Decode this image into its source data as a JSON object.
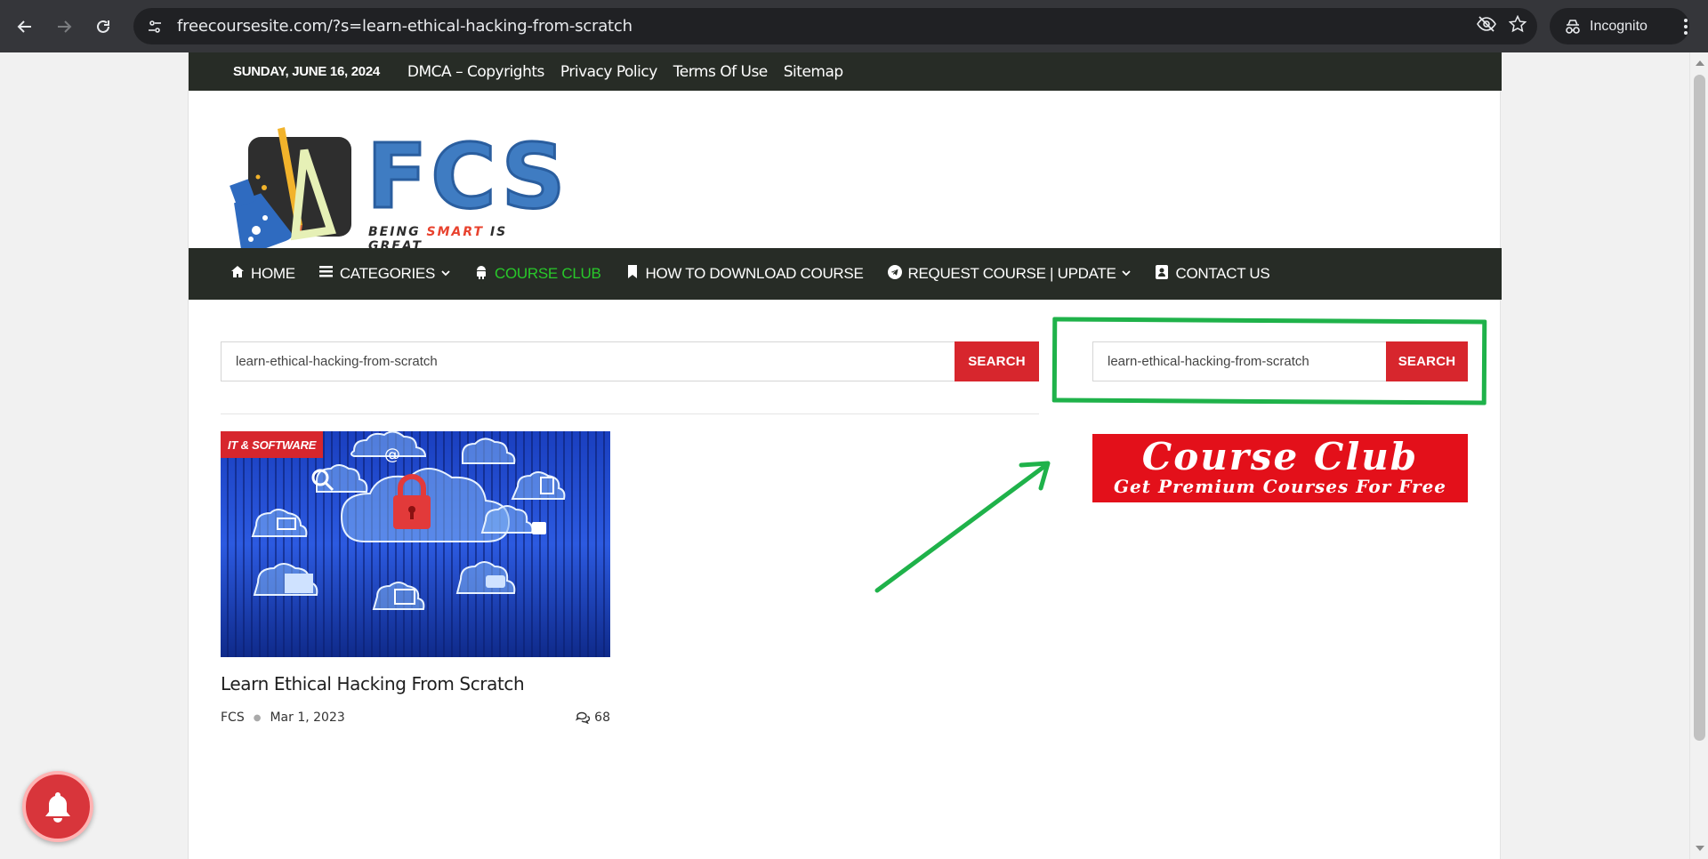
{
  "browser": {
    "url": "freecoursesite.com/?s=learn-ethical-hacking-from-scratch",
    "profile_label": "Incognito"
  },
  "topbar": {
    "date": "SUNDAY, JUNE 16, 2024",
    "links": [
      "DMCA – Copyrights",
      "Privacy Policy",
      "Terms Of Use",
      "Sitemap"
    ]
  },
  "logo": {
    "letters": "FCS",
    "tag_before": "BEING ",
    "tag_highlight": "SMART",
    "tag_after": " IS GREAT"
  },
  "mainnav": {
    "items": [
      {
        "label": "HOME",
        "icon": "home-icon"
      },
      {
        "label": "CATEGORIES",
        "icon": "menu-icon"
      },
      {
        "label": "COURSE CLUB",
        "icon": "android-icon"
      },
      {
        "label": "HOW TO DOWNLOAD COURSE",
        "icon": "bookmark-icon"
      },
      {
        "label": "REQUEST COURSE | UPDATE",
        "icon": "telegram-icon"
      },
      {
        "label": "CONTACT US",
        "icon": "contact-icon"
      }
    ],
    "active_color": "#28c82a"
  },
  "search_main": {
    "value": "learn-ethical-hacking-from-scratch",
    "button": "SEARCH"
  },
  "search_side": {
    "value": "learn-ethical-hacking-from-scratch",
    "button": "SEARCH"
  },
  "banner": {
    "title": "Course Club",
    "subtitle": "Get Premium Courses For Free"
  },
  "post": {
    "category": "IT & SOFTWARE",
    "title": "Learn Ethical Hacking From Scratch",
    "author": "FCS",
    "date": "Mar 1, 2023",
    "comments": "68"
  },
  "colors": {
    "dark_bar": "#272c26",
    "accent_red": "#d7262d",
    "annotation_green": "#1fb24a"
  }
}
